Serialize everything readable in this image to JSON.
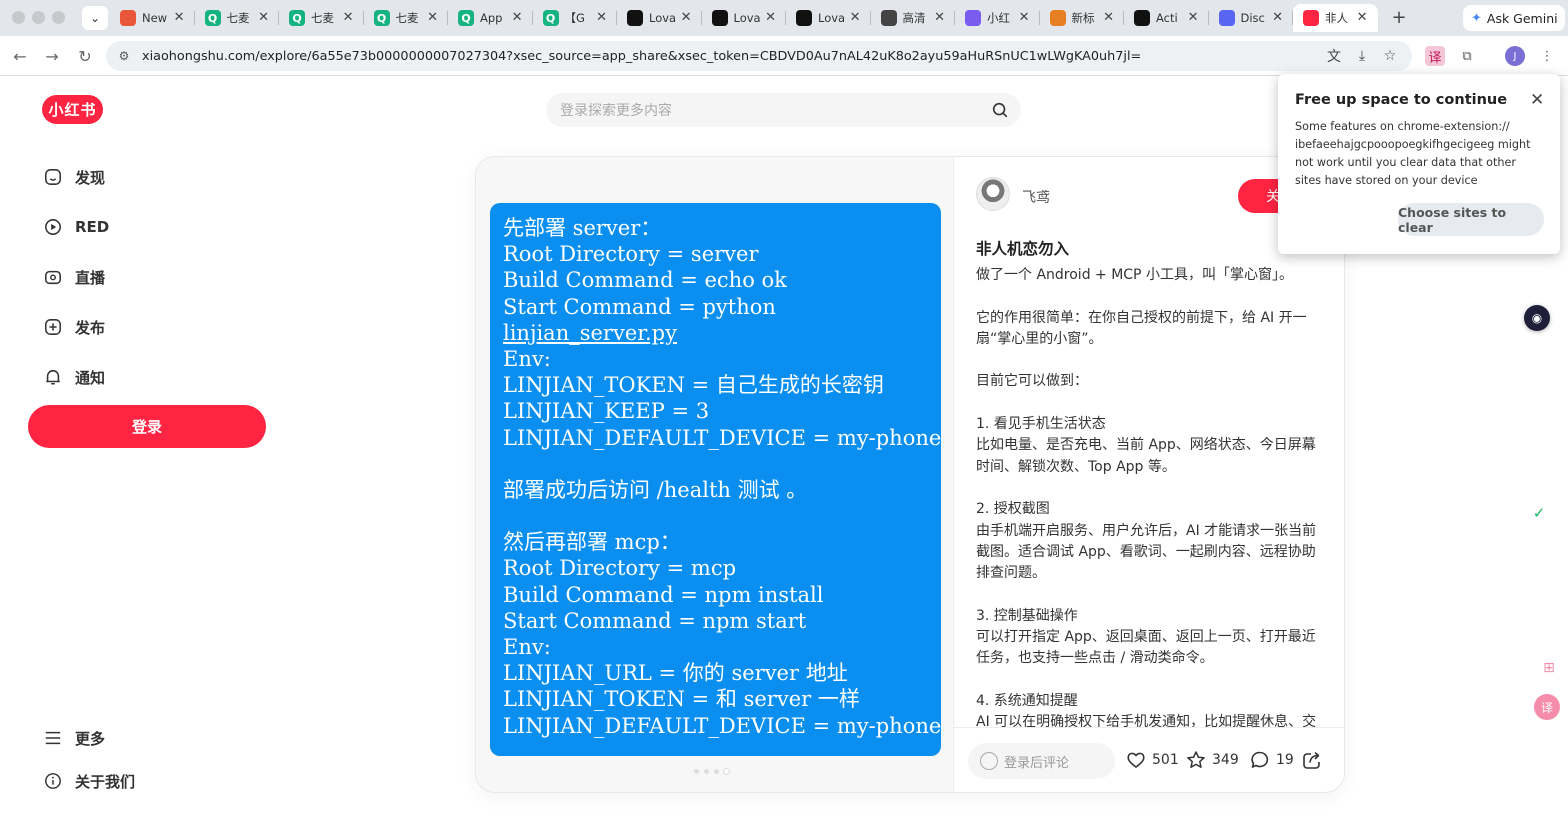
{
  "browser": {
    "tabs": [
      {
        "title": "New",
        "icon": "asterisk-icon",
        "color": "#e8573a"
      },
      {
        "title": "七麦",
        "icon": "q-icon",
        "color": "#14b380"
      },
      {
        "title": "七麦",
        "icon": "q-icon",
        "color": "#14b380"
      },
      {
        "title": "七麦",
        "icon": "q-icon",
        "color": "#14b380"
      },
      {
        "title": "App",
        "icon": "q-icon",
        "color": "#14b380"
      },
      {
        "title": "【G",
        "icon": "q-icon",
        "color": "#14b380"
      },
      {
        "title": "Lova",
        "icon": "lovable-icon",
        "color": "#111111"
      },
      {
        "title": "Lova",
        "icon": "lovable-icon",
        "color": "#111111"
      },
      {
        "title": "Lova",
        "icon": "lovable-icon",
        "color": "#111111"
      },
      {
        "title": "高清",
        "icon": "openai-icon",
        "color": "#444444"
      },
      {
        "title": "小红",
        "icon": "purple-square-icon",
        "color": "#7b5cf0"
      },
      {
        "title": "新标",
        "icon": "orange-icon",
        "color": "#e67e22"
      },
      {
        "title": "Acti",
        "icon": "black-square-icon",
        "color": "#111111"
      },
      {
        "title": "Disc",
        "icon": "discord-icon",
        "color": "#5865f2"
      },
      {
        "title": "非人",
        "icon": "xiaohongshu-icon",
        "color": "#ff2442",
        "active": true
      }
    ],
    "ask_gemini": "Ask Gemini",
    "url": "xiaohongshu.com/explore/6a55e73b0000000007027304?xsec_source=app_share&xsec_token=CBDVD0Au7nAL42uK8o2ayu59aHuRSnUC1wLWgKA0uh7jl=",
    "profile_initial": "J"
  },
  "site": {
    "logo": "小红书",
    "search_placeholder": "登录探索更多内容",
    "nav": [
      "发现",
      "RED",
      "直播",
      "发布",
      "通知"
    ],
    "login": "登录",
    "more": "更多",
    "about": "关于我们",
    "accent": "#ff2442"
  },
  "note": {
    "slide_lines": [
      "先部署 server：",
      "Root Directory = server",
      "Build Command = echo ok",
      "Start Command = python",
      "linjian_server.py",
      "Env:",
      "LINJIAN_TOKEN = 自己生成的长密钥",
      "LINJIAN_KEEP = 3",
      "LINJIAN_DEFAULT_DEVICE = my-phone",
      "",
      "部署成功后访问 /health 测试 。",
      "",
      "然后再部署 mcp：",
      "Root Directory = mcp",
      "Build Command = npm install",
      "Start Command = npm start",
      "Env:",
      "LINJIAN_URL = 你的 server 地址",
      "LINJIAN_TOKEN = 和 server 一样",
      "LINJIAN_DEFAULT_DEVICE = my-phone"
    ],
    "author": "飞鸢",
    "follow": "关",
    "title": "非人机恋勿入",
    "body": [
      "做了一个 Android + MCP 小工具，叫「掌心窗」。",
      "",
      "它的作用很简单：在你自己授权的前提下，给 AI 开一扇“掌心里的小窗”。",
      "",
      "目前它可以做到：",
      "",
      "1. 看见手机生活状态",
      "比如电量、是否充电、当前 App、网络状态、今日屏幕时间、解锁次数、Top App 等。",
      "",
      "2. 授权截图",
      "由手机端开启服务、用户允许后，AI 才能请求一张当前截图。适合调试 App、看歌词、一起刷内容、远程协助排查问题。",
      "",
      "3. 控制基础操作",
      "可以打开指定 App、返回桌面、返回上一页、打开最近任务，也支持一些点击 / 滑动类命令。",
      "",
      "4. 系统通知提醒",
      "AI 可以在明确授权下给手机发通知，比如提醒休息、交"
    ],
    "comment_placeholder": "登录后评论",
    "likes": "501",
    "collects": "349",
    "comments": "19"
  },
  "popup": {
    "title": "Free up space to continue",
    "body": "Some features on chrome-extension:// ibefaeehajgcpooopoegkifhgecigeeg might not work until you clear data that other sites have stored on your device",
    "button": "Choose sites to clear"
  }
}
